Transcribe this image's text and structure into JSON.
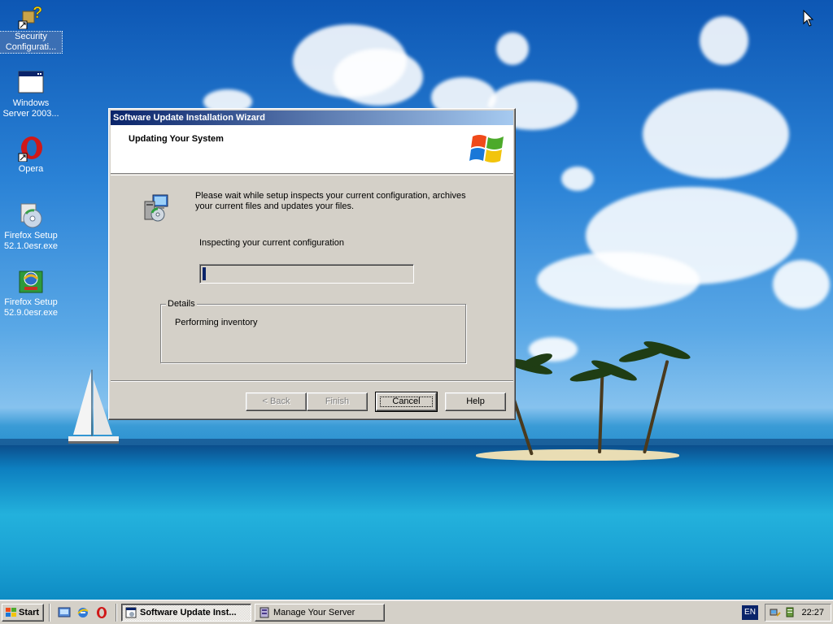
{
  "desktop": {
    "icons": [
      {
        "label": "Security Configurati...",
        "icon": "security-config-icon"
      },
      {
        "label": "Windows Server 2003...",
        "icon": "windows-window-icon"
      },
      {
        "label": "Opera",
        "icon": "opera-icon"
      },
      {
        "label": "Firefox Setup 52.1.0esr.exe",
        "icon": "setup-cd-icon"
      },
      {
        "label": "Firefox Setup 52.9.0esr.exe",
        "icon": "setup-globe-icon"
      }
    ]
  },
  "wizard": {
    "title": "Software Update Installation Wizard",
    "header_title": "Updating Your System",
    "description": "Please wait while setup inspects your current configuration, archives your current files and updates your files.",
    "status": "Inspecting your current configuration",
    "progress": 0.01,
    "details_label": "Details",
    "details_text": "Performing inventory",
    "buttons": {
      "back": "< Back",
      "finish": "Finish",
      "cancel": "Cancel",
      "help": "Help"
    }
  },
  "taskbar": {
    "start_label": "Start",
    "tasks": [
      {
        "label": "Software Update Inst...",
        "active": true
      },
      {
        "label": "Manage Your Server",
        "active": false
      }
    ],
    "language": "EN",
    "clock": "22:27"
  },
  "colors": {
    "title_bar": "#0a246a",
    "window_face": "#d4d0c8",
    "progress_fill": "#0a246a"
  }
}
